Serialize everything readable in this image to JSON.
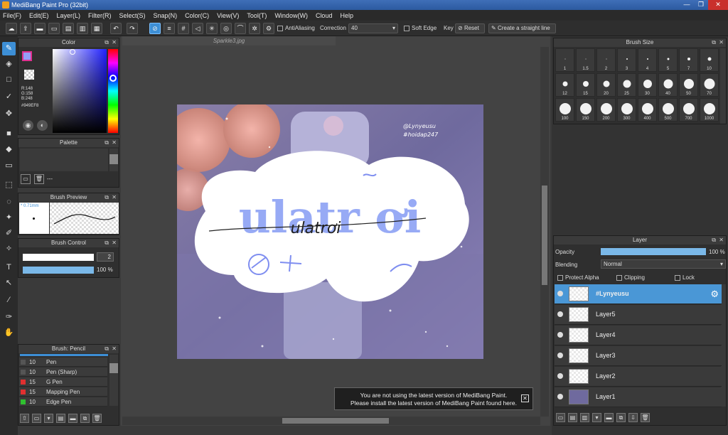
{
  "window": {
    "title": "MediBang Paint Pro (32bit)",
    "min": "—",
    "max": "❐",
    "close": "✕"
  },
  "menu": [
    "File(F)",
    "Edit(E)",
    "Layer(L)",
    "Filter(R)",
    "Select(S)",
    "Snap(N)",
    "Color(C)",
    "View(V)",
    "Tool(T)",
    "Window(W)",
    "Cloud",
    "Help"
  ],
  "toolbar": {
    "antialiasing": "AntiAliasing",
    "correction_label": "Correction",
    "correction_value": "40",
    "soft_edge": "Soft Edge",
    "key_label": "Key",
    "reset": "Reset",
    "straight_line": "Create a straight line"
  },
  "color_panel": {
    "title": "Color",
    "r": "R:148",
    "g": "G:158",
    "b": "B:248",
    "hex": "#949EF8"
  },
  "palette_panel": {
    "title": "Palette",
    "item": "---"
  },
  "brush_preview": {
    "title": "Brush Preview",
    "size": "* 0.71mm"
  },
  "brush_control": {
    "title": "Brush Control",
    "size": "2",
    "opacity": "100 %",
    "opacity_fill": 1.0
  },
  "brush_panel": {
    "title": "Brush: Pencil",
    "items": [
      {
        "num": "10",
        "name": "Pen",
        "color": "#555555"
      },
      {
        "num": "10",
        "name": "Pen (Sharp)",
        "color": "#555555"
      },
      {
        "num": "15",
        "name": "G Pen",
        "color": "#e03030"
      },
      {
        "num": "15",
        "name": "Mapping Pen",
        "color": "#e03030"
      },
      {
        "num": "10",
        "name": "Edge Pen",
        "color": "#30c030"
      }
    ]
  },
  "document": {
    "tab": "Sparkle3.jpg"
  },
  "artwork": {
    "watermark1": "@Lynyeusu",
    "watermark2": "#hoidap247",
    "text": "ulatr ơi",
    "script_text": "ulatrơi"
  },
  "notice": {
    "line1": "You are not using the latest version of MediBang Paint.",
    "line2": "Please install the latest version of MediBang Paint found here.",
    "close": "✕"
  },
  "brush_size": {
    "title": "Brush Size",
    "sizes": [
      "1",
      "1.5",
      "2",
      "3",
      "4",
      "5",
      "7",
      "10",
      "12",
      "15",
      "20",
      "25",
      "30",
      "40",
      "50",
      "70",
      "100",
      "150",
      "200",
      "300",
      "400",
      "500",
      "700",
      "1000"
    ]
  },
  "layer_panel": {
    "title": "Layer",
    "opacity_label": "Opacity",
    "opacity_value": "100 %",
    "opacity_fill": 1.0,
    "blending_label": "Blending",
    "blending_value": "Normal",
    "protect_alpha": "Protect Alpha",
    "clipping": "Clipping",
    "lock": "Lock",
    "layers": [
      {
        "name": "#Lynyeusu",
        "selected": true
      },
      {
        "name": "Layer5",
        "selected": false
      },
      {
        "name": "Layer4",
        "selected": false
      },
      {
        "name": "Layer3",
        "selected": false
      },
      {
        "name": "Layer2",
        "selected": false
      },
      {
        "name": "Layer1",
        "selected": false
      }
    ]
  }
}
